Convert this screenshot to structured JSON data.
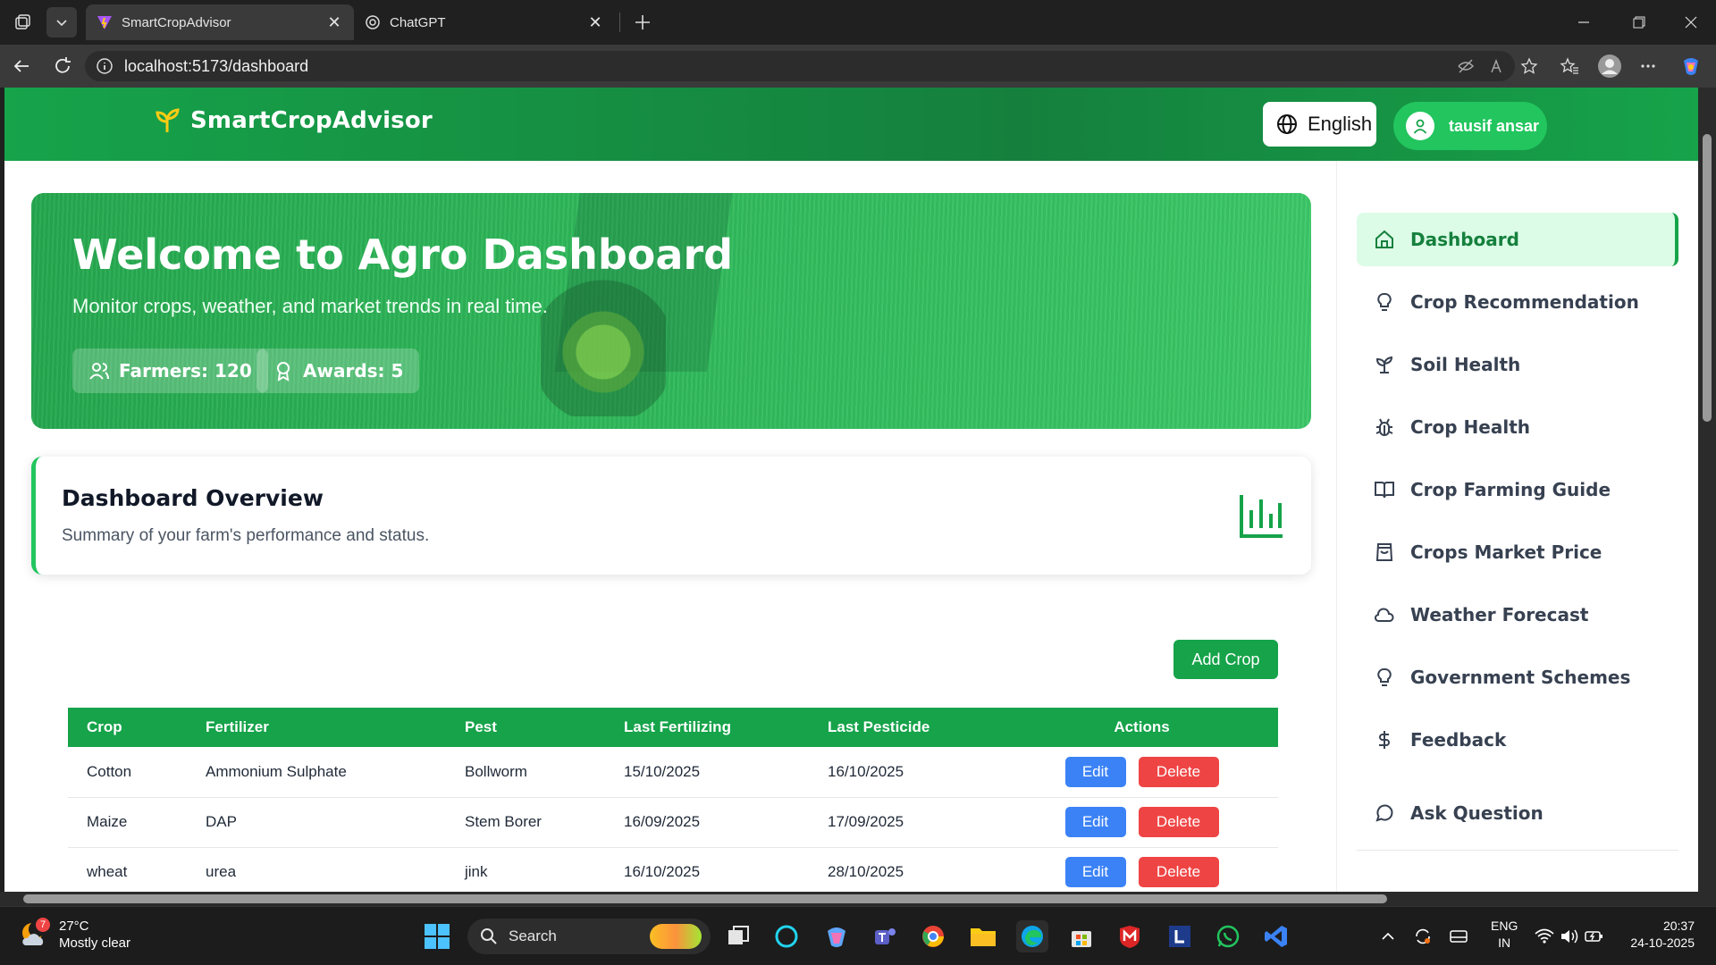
{
  "browser": {
    "tabs": [
      {
        "title": "SmartCropAdvisor",
        "active": true
      },
      {
        "title": "ChatGPT",
        "active": false
      }
    ],
    "url": "localhost:5173/dashboard"
  },
  "header": {
    "brand": "SmartCropAdvisor",
    "language_button": "English",
    "user_name": "tausif ansar"
  },
  "hero": {
    "title": "Welcome to Agro Dashboard",
    "subtitle": "Monitor crops, weather, and market trends in real time.",
    "badges": [
      {
        "label": "Farmers: 120",
        "icon": "users-icon"
      },
      {
        "label": "Awards: 5",
        "icon": "award-icon"
      }
    ]
  },
  "overview": {
    "title": "Dashboard Overview",
    "subtitle": "Summary of your farm's performance and status.",
    "icon": "bar-chart-icon"
  },
  "add_crop_button": "Add Crop",
  "table": {
    "headers": [
      "Crop",
      "Fertilizer",
      "Pest",
      "Last Fertilizing",
      "Last Pesticide",
      "Actions"
    ],
    "rows": [
      [
        "Cotton",
        "Ammonium Sulphate",
        "Bollworm",
        "15/10/2025",
        "16/10/2025"
      ],
      [
        "Maize",
        "DAP",
        "Stem Borer",
        "16/09/2025",
        "17/09/2025"
      ],
      [
        "wheat",
        "urea",
        "jink",
        "16/10/2025",
        "28/10/2025"
      ]
    ],
    "edit_label": "Edit",
    "delete_label": "Delete"
  },
  "sidebar": {
    "items": [
      {
        "label": "Dashboard",
        "icon": "home-icon",
        "active": true
      },
      {
        "label": "Crop Recommendation",
        "icon": "lightbulb-icon"
      },
      {
        "label": "Soil Health",
        "icon": "sprout-icon"
      },
      {
        "label": "Crop Health",
        "icon": "bug-icon"
      },
      {
        "label": "Crop Farming Guide",
        "icon": "book-icon"
      },
      {
        "label": "Crops Market Price",
        "icon": "shopping-bag-icon"
      },
      {
        "label": "Weather Forecast",
        "icon": "cloud-icon"
      },
      {
        "label": "Government Schemes",
        "icon": "lightbulb-icon"
      },
      {
        "label": "Feedback",
        "icon": "dollar-icon"
      }
    ],
    "extra_item": {
      "label": "Ask Question",
      "icon": "message-icon"
    }
  },
  "taskbar": {
    "weather_badge": "7",
    "temperature": "27°C",
    "condition": "Mostly clear",
    "search_placeholder": "Search",
    "language": "ENG",
    "region": "IN",
    "time": "20:37",
    "date": "24-10-2025"
  },
  "colors": {
    "brand_green": "#16a34a",
    "accent_green": "#22c55e",
    "edit_blue": "#3b82f6",
    "delete_red": "#ef4444"
  }
}
